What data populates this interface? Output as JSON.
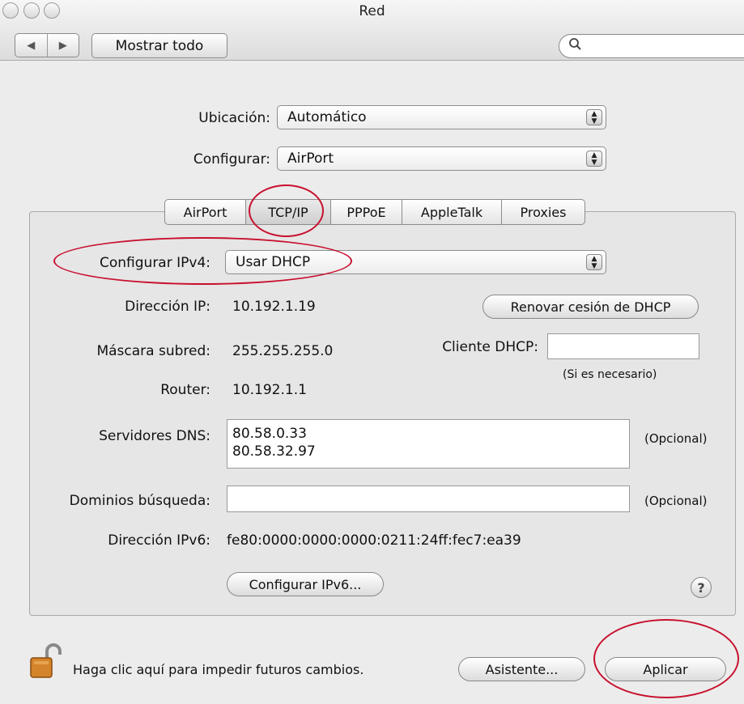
{
  "window": {
    "title": "Red"
  },
  "toolbar": {
    "back_arrow": "◀",
    "forward_arrow": "▶",
    "show_all": "Mostrar todo",
    "search_placeholder": ""
  },
  "location": {
    "label": "Ubicación:",
    "value": "Automático"
  },
  "configure": {
    "label": "Configurar:",
    "value": "AirPort"
  },
  "tabs": [
    {
      "label": "AirPort",
      "selected": false
    },
    {
      "label": "TCP/IP",
      "selected": true
    },
    {
      "label": "PPPoE",
      "selected": false
    },
    {
      "label": "AppleTalk",
      "selected": false
    },
    {
      "label": "Proxies",
      "selected": false
    }
  ],
  "tcpip": {
    "ipv4_label": "Configurar IPv4:",
    "ipv4_value": "Usar DHCP",
    "ip_label": "Dirección IP:",
    "ip_value": "10.192.1.19",
    "renew_button": "Renovar cesión de DHCP",
    "mask_label": "Máscara subred:",
    "mask_value": "255.255.255.0",
    "dhcp_client_label": "Cliente DHCP:",
    "dhcp_client_value": "",
    "dhcp_hint": "(Si es necesario)",
    "router_label": "Router:",
    "router_value": "10.192.1.1",
    "dns_label": "Servidores DNS:",
    "dns_servers": [
      "80.58.0.33",
      "80.58.32.97"
    ],
    "dns_optional": "(Opcional)",
    "domains_label": "Dominios búsqueda:",
    "domains_value": "",
    "domains_optional": "(Opcional)",
    "ipv6_label": "Dirección IPv6:",
    "ipv6_value": "fe80:0000:0000:0000:0211:24ff:fec7:ea39",
    "configure_ipv6_button": "Configurar IPv6...",
    "help_glyph": "?"
  },
  "footer": {
    "lock_text": "Haga clic aquí para impedir futuros cambios.",
    "assistant_button": "Asistente...",
    "apply_button": "Aplicar"
  },
  "icons": [
    "close-icon",
    "minimize-icon",
    "zoom-icon",
    "back-arrow-icon",
    "forward-arrow-icon",
    "search-icon",
    "stepper-icon",
    "help-icon",
    "lock-icon"
  ],
  "colors": {
    "annotation_red": "#c8102e",
    "window_bg": "#ececec"
  }
}
